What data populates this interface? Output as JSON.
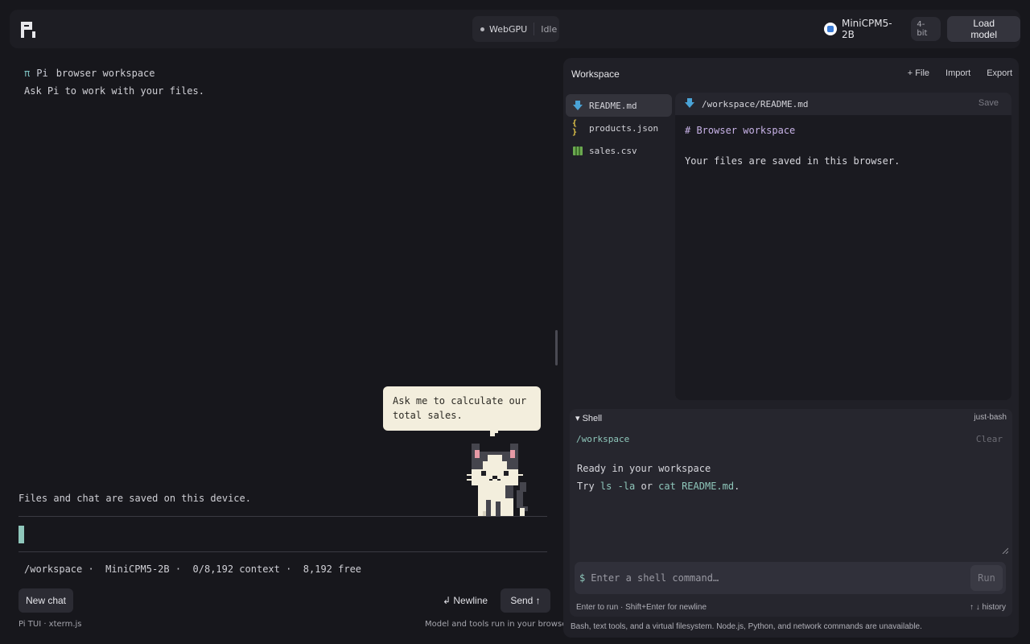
{
  "header": {
    "logo_icon": "pi-logo-icon",
    "backend": "WebGPU",
    "state": "Idle",
    "model_name": "MiniCPM5-2B",
    "quantization": "4-bit",
    "load_button": "Load model"
  },
  "terminal": {
    "pi_symbol": "π",
    "name": "Pi",
    "title": "browser workspace",
    "intro": "Ask Pi to work with your files.",
    "bubble": "Ask me to calculate our total sales.",
    "saved_note": "Files and chat are saved on this device.",
    "status_line": "/workspace ·  MiniCPM5-2B ·  0/8,192 context ·  8,192 free",
    "mascot_icon": "pixel-cat-icon"
  },
  "chat_footer": {
    "new_chat": "New chat",
    "newline": "↲ Newline",
    "send": "Send ↑",
    "credits": "Pi TUI · xterm.js",
    "note": "Model and tools run in your browser"
  },
  "workspace": {
    "title": "Workspace",
    "actions": {
      "new_file": "+ File",
      "import": "Import",
      "export": "Export"
    },
    "files": [
      {
        "name": "README.md",
        "icon": "markdown-icon",
        "active": true
      },
      {
        "name": "products.json",
        "icon": "json-icon",
        "active": false
      },
      {
        "name": "sales.csv",
        "icon": "spreadsheet-icon",
        "active": false
      }
    ],
    "editor": {
      "path": "/workspace/README.md",
      "save": "Save",
      "lines": [
        "# Browser workspace",
        "",
        "Your files are saved in this browser."
      ]
    },
    "shell": {
      "title": "▾ Shell",
      "tag": "just-bash",
      "cwd": "/workspace",
      "clear": "Clear",
      "ready": "Ready in your workspace",
      "try_prefix": "Try ",
      "try_cmd1": "ls -la",
      "try_or": " or ",
      "try_cmd2": "cat README.md",
      "try_suffix": ".",
      "prompt": "$",
      "placeholder": "Enter a shell command…",
      "run": "Run",
      "hint": "Enter to run · Shift+Enter for newline",
      "history": "↑ ↓  history"
    },
    "footer": "Bash, text tools, and a virtual filesystem. Node.js, Python, and network commands are unavailable."
  },
  "colors": {
    "background": "#17171c",
    "accent_teal": "#8fc7bb",
    "bubble": "#f3eedd",
    "heading_purple": "#c7b2e6"
  }
}
